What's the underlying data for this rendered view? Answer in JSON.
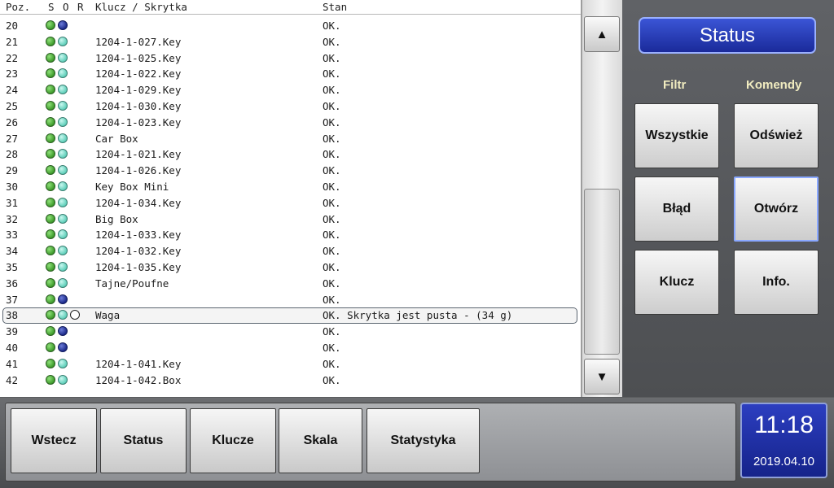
{
  "list": {
    "headers": {
      "pos": "Poz.",
      "s": "S",
      "o": "O",
      "r": "R",
      "key": "Klucz / Skrytka",
      "stan": "Stan"
    },
    "rows": [
      {
        "pos": "20",
        "dots": [
          "green",
          "navy"
        ],
        "key": "",
        "stan": "OK."
      },
      {
        "pos": "21",
        "dots": [
          "green",
          "cyan"
        ],
        "key": "1204-1-027.Key",
        "stan": "OK."
      },
      {
        "pos": "22",
        "dots": [
          "green",
          "cyan"
        ],
        "key": "1204-1-025.Key",
        "stan": "OK."
      },
      {
        "pos": "23",
        "dots": [
          "green",
          "cyan"
        ],
        "key": "1204-1-022.Key",
        "stan": "OK."
      },
      {
        "pos": "24",
        "dots": [
          "green",
          "cyan"
        ],
        "key": "1204-1-029.Key",
        "stan": "OK."
      },
      {
        "pos": "25",
        "dots": [
          "green",
          "cyan"
        ],
        "key": "1204-1-030.Key",
        "stan": "OK."
      },
      {
        "pos": "26",
        "dots": [
          "green",
          "cyan"
        ],
        "key": "1204-1-023.Key",
        "stan": "OK."
      },
      {
        "pos": "27",
        "dots": [
          "green",
          "cyan"
        ],
        "key": "Car Box",
        "stan": "OK."
      },
      {
        "pos": "28",
        "dots": [
          "green",
          "cyan"
        ],
        "key": "1204-1-021.Key",
        "stan": "OK."
      },
      {
        "pos": "29",
        "dots": [
          "green",
          "cyan"
        ],
        "key": "1204-1-026.Key",
        "stan": "OK."
      },
      {
        "pos": "30",
        "dots": [
          "green",
          "cyan"
        ],
        "key": "Key Box Mini",
        "stan": "OK."
      },
      {
        "pos": "31",
        "dots": [
          "green",
          "cyan"
        ],
        "key": "1204-1-034.Key",
        "stan": "OK."
      },
      {
        "pos": "32",
        "dots": [
          "green",
          "cyan"
        ],
        "key": "Big Box",
        "stan": "OK."
      },
      {
        "pos": "33",
        "dots": [
          "green",
          "cyan"
        ],
        "key": "1204-1-033.Key",
        "stan": "OK."
      },
      {
        "pos": "34",
        "dots": [
          "green",
          "cyan"
        ],
        "key": "1204-1-032.Key",
        "stan": "OK."
      },
      {
        "pos": "35",
        "dots": [
          "green",
          "cyan"
        ],
        "key": "1204-1-035.Key",
        "stan": "OK."
      },
      {
        "pos": "36",
        "dots": [
          "green",
          "cyan"
        ],
        "key": "Tajne/Poufne",
        "stan": "OK."
      },
      {
        "pos": "37",
        "dots": [
          "green",
          "navy"
        ],
        "key": "",
        "stan": "OK."
      },
      {
        "pos": "38",
        "dots": [
          "green",
          "cyan",
          "white"
        ],
        "key": "Waga",
        "stan": "OK. Skrytka jest pusta - (34 g)",
        "selected": true
      },
      {
        "pos": "39",
        "dots": [
          "green",
          "navy"
        ],
        "key": "",
        "stan": "OK."
      },
      {
        "pos": "40",
        "dots": [
          "green",
          "navy"
        ],
        "key": "",
        "stan": "OK."
      },
      {
        "pos": "41",
        "dots": [
          "green",
          "cyan"
        ],
        "key": "1204-1-041.Key",
        "stan": "OK."
      },
      {
        "pos": "42",
        "dots": [
          "green",
          "cyan"
        ],
        "key": "1204-1-042.Box",
        "stan": "OK."
      }
    ]
  },
  "scrollbar": {
    "up_icon": "▲",
    "down_icon": "▼"
  },
  "panel": {
    "title": "Status",
    "filtr_label": "Filtr",
    "komendy_label": "Komendy",
    "buttons": {
      "wszystkie": "Wszystkie",
      "odswiez": "Odśwież",
      "blad": "Błąd",
      "otworz": "Otwórz",
      "klucz": "Klucz",
      "info": "Info."
    }
  },
  "nav": {
    "wstecz": "Wstecz",
    "status": "Status",
    "klucze": "Klucze",
    "skala": "Skala",
    "statystyka": "Statystyka"
  },
  "clock": {
    "time": "11:18",
    "date": "2019.04.10"
  },
  "colors": {
    "accent_blue": "#2236b4",
    "title_yellow": "#f1ecc0",
    "dot_green": "#3d9a2a",
    "dot_cyan": "#5fcfba",
    "dot_navy": "#1d2b8a"
  }
}
